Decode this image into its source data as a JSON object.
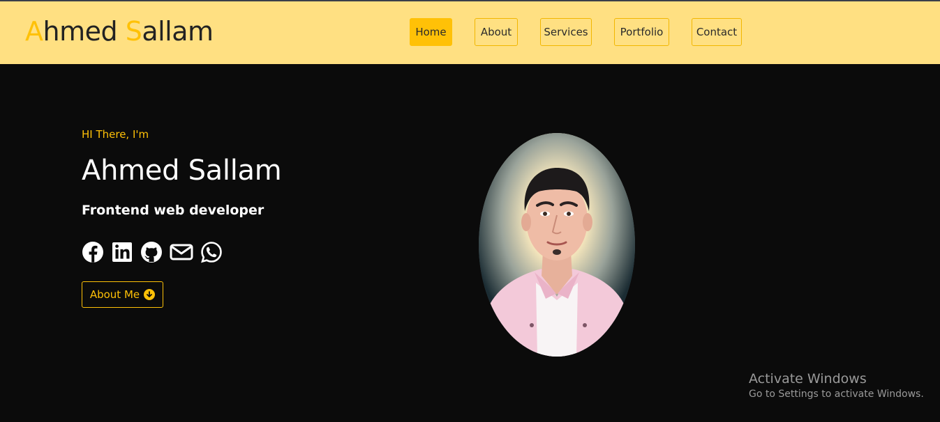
{
  "brand": {
    "first_initial": "A",
    "first_rest": "hmed ",
    "last_initial": "S",
    "last_rest": "allam"
  },
  "nav": [
    {
      "label": "Home",
      "active": true
    },
    {
      "label": "About",
      "active": false
    },
    {
      "label": "Services",
      "active": false
    },
    {
      "label": "Portfolio",
      "active": false
    },
    {
      "label": "Contact",
      "active": false
    }
  ],
  "hero": {
    "greeting": "HI There, I'm",
    "name": "Ahmed Sallam",
    "role": "Frontend web developer",
    "socials": [
      "facebook-icon",
      "linkedin-icon",
      "github-icon",
      "envelope-icon",
      "whatsapp-icon"
    ],
    "cta_label": "About Me"
  },
  "watermark": {
    "title": "Activate Windows",
    "subtitle": "Go to Settings to activate Windows."
  },
  "colors": {
    "header_bg": "#ffe082",
    "accent": "#ffc107",
    "page_bg": "#0b0b0b",
    "text_light": "#ffffff"
  }
}
